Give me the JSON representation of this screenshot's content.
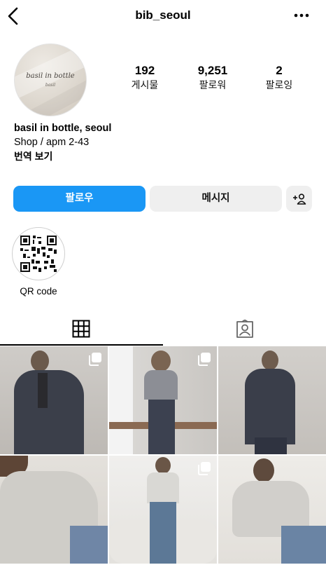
{
  "header": {
    "username": "bib_seoul"
  },
  "profile": {
    "avatar_logo": "basil in bottle",
    "avatar_logo_sub": "basil",
    "stats": [
      {
        "value": "192",
        "label": "게시물"
      },
      {
        "value": "9,251",
        "label": "팔로워"
      },
      {
        "value": "2",
        "label": "팔로잉"
      }
    ],
    "name": "basil in bottle, seoul",
    "category": "Shop / apm 2-43",
    "translate": "번역 보기"
  },
  "actions": {
    "follow": "팔로우",
    "message": "메시지",
    "add_user": "+8"
  },
  "highlight": {
    "label": "QR code"
  },
  "tabs": [
    "grid-icon",
    "tagged-icon"
  ],
  "posts": [
    {
      "icon": "multiple-posts-icon"
    },
    {
      "icon": "multiple-posts-icon"
    },
    {
      "icon": ""
    },
    {
      "icon": ""
    },
    {
      "icon": "multiple-posts-icon"
    },
    {
      "icon": ""
    }
  ],
  "colors": {
    "accent": "#1a97f5",
    "secondary_button": "#efefef"
  }
}
